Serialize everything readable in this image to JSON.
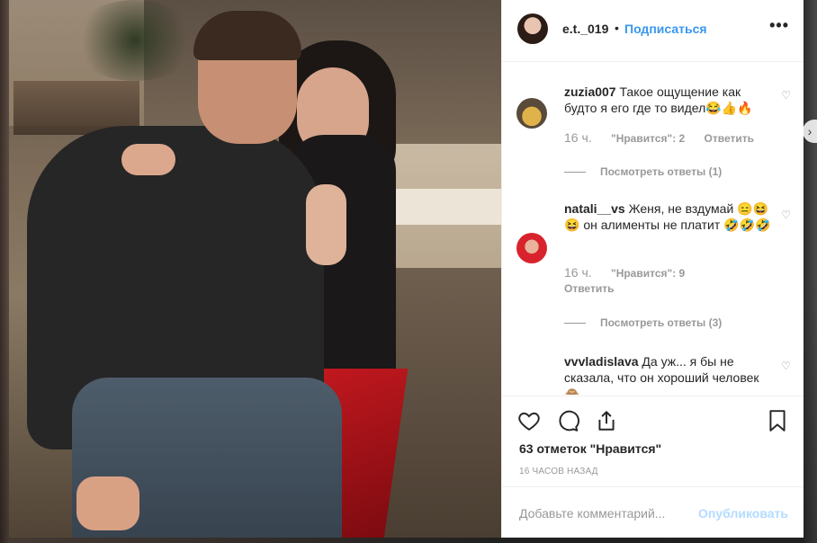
{
  "header": {
    "username": "e.t._019",
    "dot": "•",
    "follow_label": "Подписаться",
    "more_label": "•••"
  },
  "comments": [
    {
      "username": "zuzia007",
      "text": "Такое ощущение как будто я его где то видел😂👍🔥",
      "time": "16 ч.",
      "likes": "\"Нравится\": 2",
      "reply": "Ответить",
      "view_replies": "Посмотреть ответы (1)",
      "avatar_color": "#c7a050"
    },
    {
      "username": "natali__vs",
      "text": "Женя, не вздумай 😑😆😆 он алименты не платит 🤣🤣🤣",
      "time": "16 ч.",
      "likes": "\"Нравится\": 9",
      "reply": "Ответить",
      "view_replies": "Посмотреть ответы (3)",
      "avatar_color": "#d9232c"
    },
    {
      "username": "vvvladislava",
      "text": "Да уж... я бы не сказала, что он хороший человек 🙈 ...",
      "avatar_color": "#8a6a5a"
    }
  ],
  "actions": {
    "like_icon": "heart-icon",
    "comment_icon": "comment-icon",
    "share_icon": "share-icon",
    "save_icon": "bookmark-icon",
    "likes_text": "63 отметок \"Нравится\"",
    "time_ago": "16 ЧАСОВ НАЗАД"
  },
  "add_comment": {
    "placeholder": "Добавьте комментарий...",
    "publish_label": "Опубликовать"
  },
  "colors": {
    "accent": "#3897f0",
    "publish_disabled": "#b3dbff",
    "text": "#262626",
    "muted": "#999999"
  }
}
